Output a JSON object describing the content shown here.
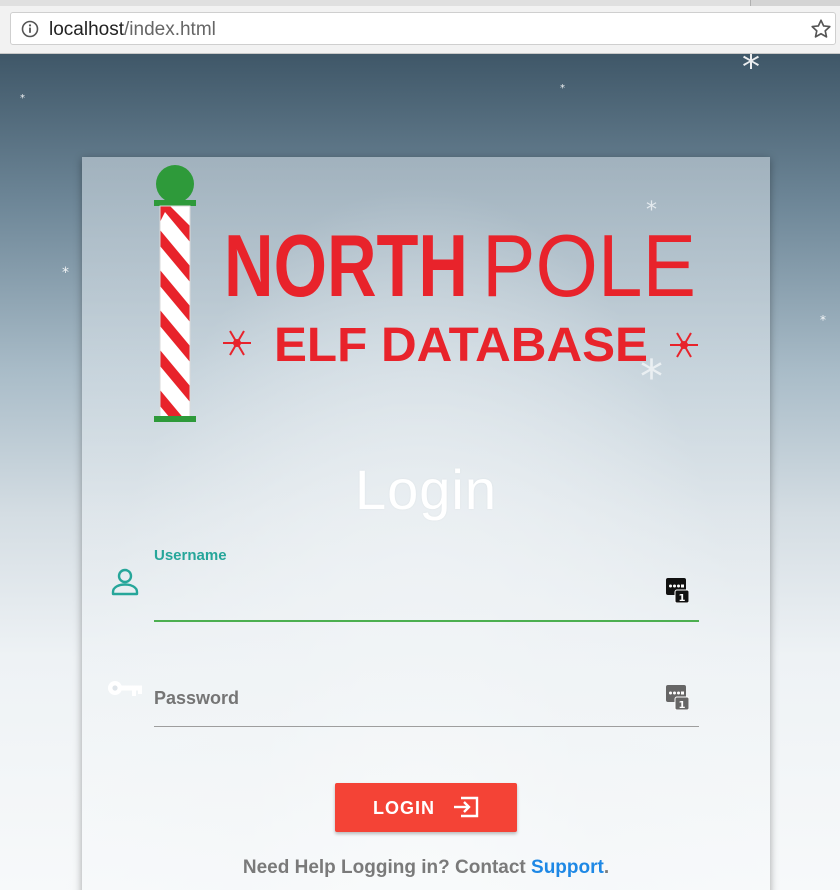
{
  "browser": {
    "url_host": "localhost",
    "url_path": "/index.html"
  },
  "logo": {
    "line1_bold": "NORTH",
    "line1_light": "POLE",
    "line2": "ELF DATABASE"
  },
  "login": {
    "title": "Login",
    "username_label": "Username",
    "username_value": "",
    "password_placeholder": "Password",
    "button_label": "LOGIN",
    "help_text": "Need Help Logging in? Contact ",
    "help_link": "Support",
    "help_suffix": "."
  },
  "colors": {
    "accent_red": "#f44336",
    "teal": "#26a69a",
    "underline_green": "#4caf50",
    "link_blue": "#1e88e5",
    "logo_red": "#e8232b"
  },
  "icons": [
    "info-icon",
    "bookmark-star-icon",
    "person-icon",
    "key-icon",
    "password-manager-icon",
    "login-arrow-icon",
    "snowflake-icon"
  ]
}
